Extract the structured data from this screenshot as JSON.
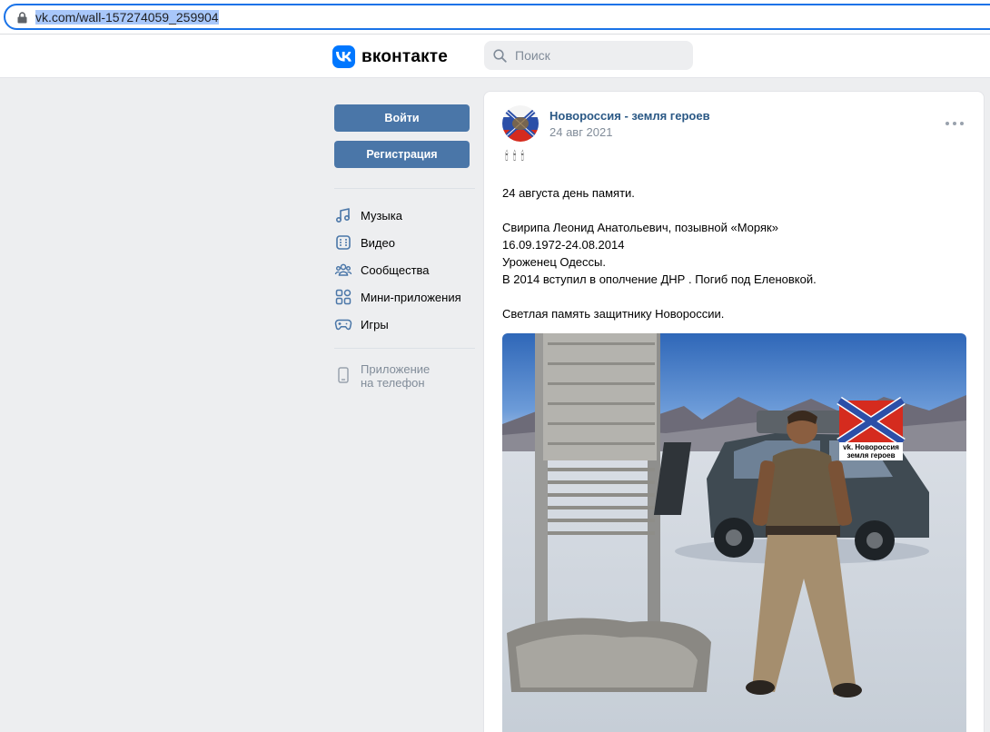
{
  "browser": {
    "url": "vk.com/wall-157274059_259904"
  },
  "header": {
    "logo_text": "вконтакте",
    "search_placeholder": "Поиск"
  },
  "sidebar": {
    "login_label": "Войти",
    "register_label": "Регистрация",
    "items": [
      {
        "label": "Музыка",
        "icon": "music-icon"
      },
      {
        "label": "Видео",
        "icon": "video-icon"
      },
      {
        "label": "Сообщества",
        "icon": "communities-icon"
      },
      {
        "label": "Мини-приложения",
        "icon": "mini-apps-icon"
      },
      {
        "label": "Игры",
        "icon": "games-icon"
      }
    ],
    "app_line1": "Приложение",
    "app_line2": "на телефон"
  },
  "post": {
    "author": "Новороссия - земля героев",
    "date": "24 авг 2021",
    "candles": "🕯 🕯 🕯",
    "lines": [
      "24 августа день памяти.",
      "Свирипа Леонид Анатольевич, позывной «Моряк»",
      "16.09.1972-24.08.2014",
      "Уроженец Одессы.",
      "В 2014 вступил в ополчение ДНР . Погиб под Еленовкой.",
      "Светлая память защитнику Новороссии."
    ],
    "photo_watermark_line1": "vk. Новороссия",
    "photo_watermark_line2": "земля героев"
  },
  "colors": {
    "accent": "#4a76a8",
    "link": "#2a5885",
    "vk_blue": "#0077ff",
    "page_bg": "#edeef0"
  }
}
